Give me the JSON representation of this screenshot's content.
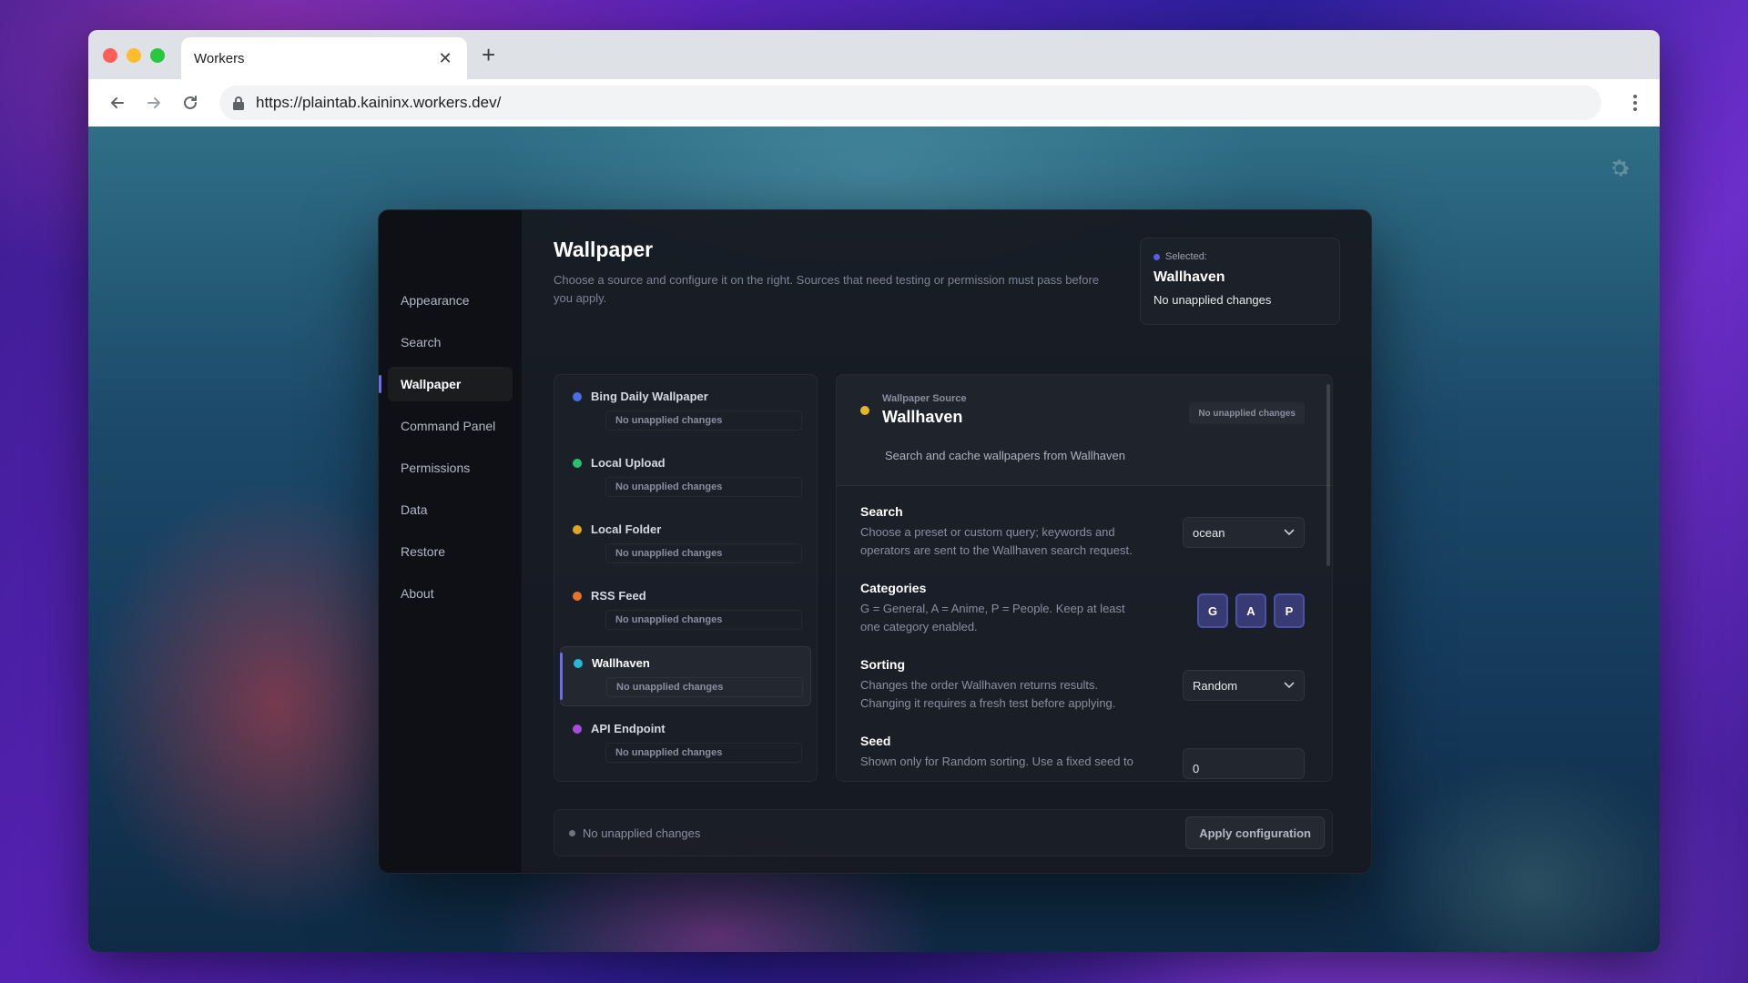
{
  "browser": {
    "tab_title": "Workers",
    "url": "https://plaintab.kaininx.workers.dev/"
  },
  "sidebar": {
    "items": [
      {
        "label": "Appearance"
      },
      {
        "label": "Search"
      },
      {
        "label": "Wallpaper",
        "active": true
      },
      {
        "label": "Command Panel"
      },
      {
        "label": "Permissions"
      },
      {
        "label": "Data"
      },
      {
        "label": "Restore"
      },
      {
        "label": "About"
      }
    ]
  },
  "header": {
    "title": "Wallpaper",
    "description": "Choose a source and configure it on the right. Sources that need testing or permission must pass before you apply."
  },
  "selected": {
    "label": "Selected:",
    "name": "Wallhaven",
    "status": "No unapplied changes",
    "dot_color": "#5b5ce6"
  },
  "sources": [
    {
      "name": "Bing Daily Wallpaper",
      "status": "No unapplied changes",
      "color": "#4a6fe3"
    },
    {
      "name": "Local Upload",
      "status": "No unapplied changes",
      "color": "#27c26b"
    },
    {
      "name": "Local Folder",
      "status": "No unapplied changes",
      "color": "#e0a623"
    },
    {
      "name": "RSS Feed",
      "status": "No unapplied changes",
      "color": "#e8742a"
    },
    {
      "name": "Wallhaven",
      "status": "No unapplied changes",
      "color": "#25b8d8",
      "active": true
    },
    {
      "name": "API Endpoint",
      "status": "No unapplied changes",
      "color": "#a84be0"
    }
  ],
  "detail": {
    "kicker": "Wallpaper Source",
    "title": "Wallhaven",
    "badge": "No unapplied changes",
    "description": "Search and cache wallpapers from Wallhaven",
    "dot_color": "#e7b52a",
    "settings": {
      "search": {
        "title": "Search",
        "description": "Choose a preset or custom query; keywords and operators are sent to the Wallhaven search request.",
        "value": "ocean"
      },
      "categories": {
        "title": "Categories",
        "description": "G = General, A = Anime, P = People. Keep at least one category enabled.",
        "options": [
          "G",
          "A",
          "P"
        ]
      },
      "sorting": {
        "title": "Sorting",
        "description": "Changes the order Wallhaven returns results. Changing it requires a fresh test before applying.",
        "value": "Random"
      },
      "seed": {
        "title": "Seed",
        "description": "Shown only for Random sorting. Use a fixed seed to",
        "value": "0"
      }
    }
  },
  "footer": {
    "status": "No unapplied changes",
    "apply_label": "Apply configuration"
  },
  "colors": {
    "accent": "#6b6cf0",
    "panel_bg": "#16181f"
  }
}
